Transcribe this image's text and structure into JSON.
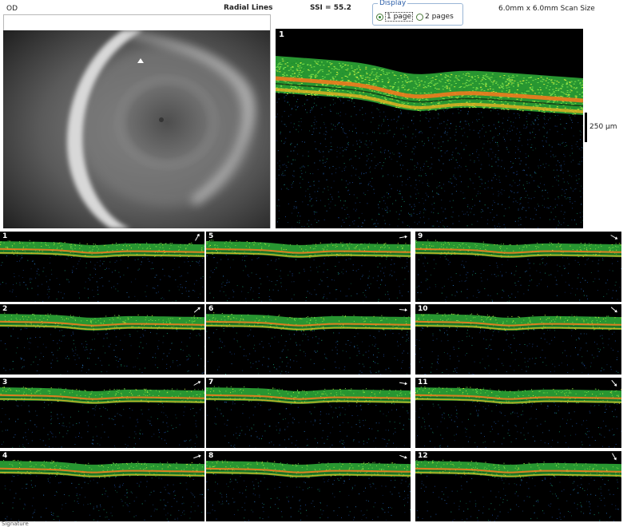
{
  "header": {
    "eye": "OD",
    "scan_type": "Radial Lines",
    "ssi": "SSI = 55.2",
    "scan_size": "6.0mm x 6.0mm Scan Size",
    "display": {
      "title": "Display",
      "options": [
        "1 page",
        "2 pages"
      ],
      "selected": "1 page"
    }
  },
  "main_scan": {
    "number": "1"
  },
  "scale": {
    "label": "250 µm"
  },
  "thumbnails": [
    {
      "number": "1"
    },
    {
      "number": "2"
    },
    {
      "number": "3"
    },
    {
      "number": "4"
    },
    {
      "number": "5"
    },
    {
      "number": "6"
    },
    {
      "number": "7"
    },
    {
      "number": "8"
    },
    {
      "number": "9"
    },
    {
      "number": "10"
    },
    {
      "number": "11"
    },
    {
      "number": "12"
    }
  ],
  "footer": {
    "text": "Signature"
  },
  "colors": {
    "retina_green": "#3cc83c",
    "rpe_orange": "#f07a1e",
    "background": "#000000"
  }
}
